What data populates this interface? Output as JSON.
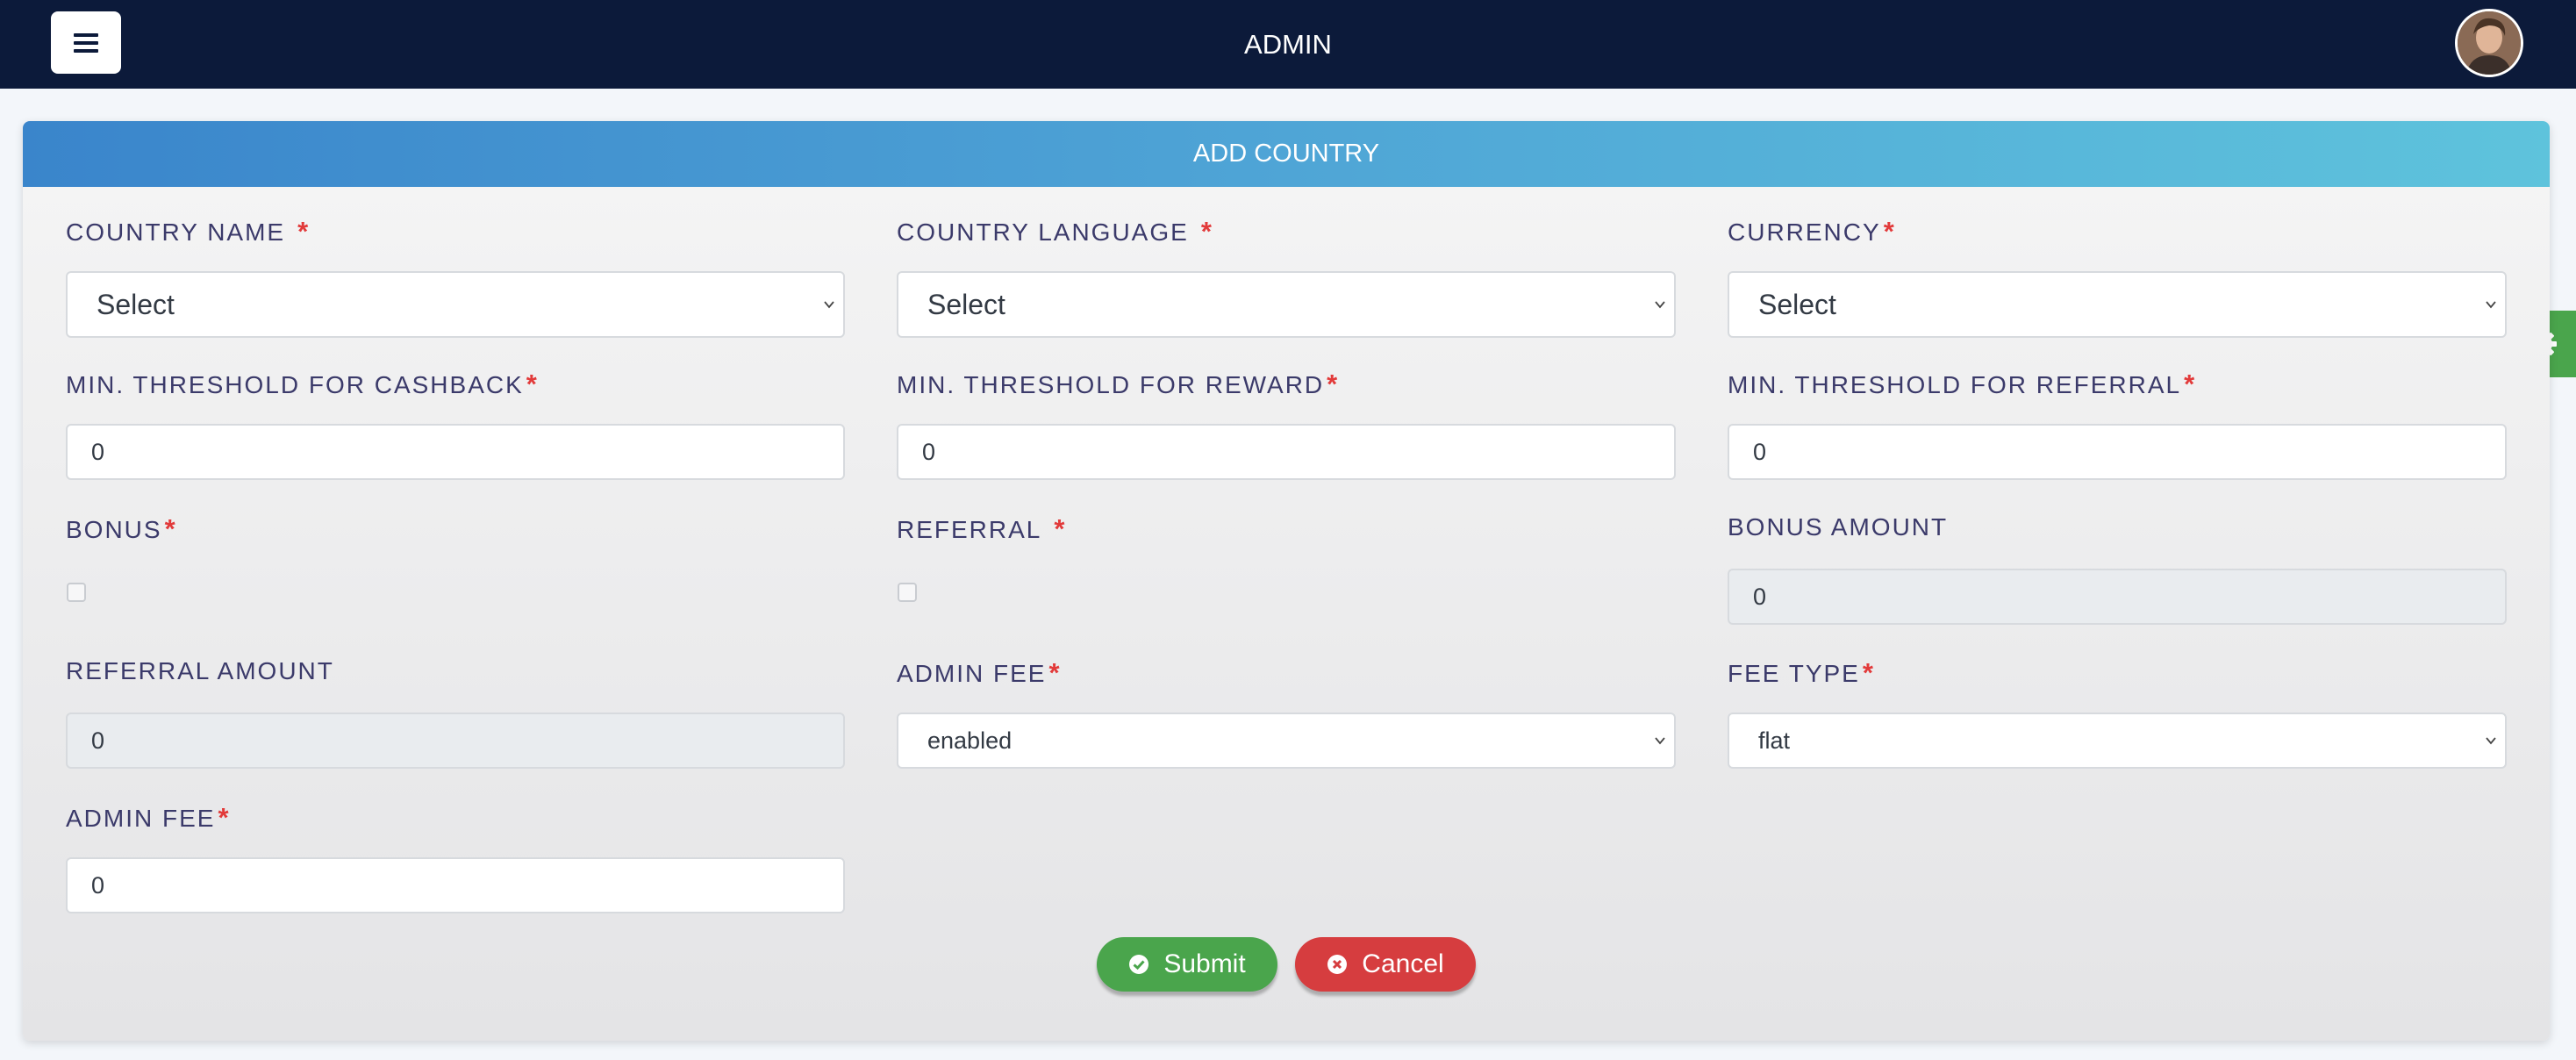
{
  "header": {
    "title": "ADMIN",
    "menu_icon": "hamburger-icon",
    "avatar_icon": "user-avatar"
  },
  "form": {
    "title": "ADD COUNTRY",
    "required_mark": "*",
    "fields": {
      "country_name": {
        "label": "COUNTRY NAME",
        "value": "Select"
      },
      "country_language": {
        "label": "COUNTRY LANGUAGE",
        "value": "Select"
      },
      "currency": {
        "label": "CURRENCY",
        "value": "Select"
      },
      "min_threshold_cashback": {
        "label": "MIN. THRESHOLD FOR CASHBACK",
        "value": "0"
      },
      "min_threshold_reward": {
        "label": "MIN. THRESHOLD FOR REWARD",
        "value": "0"
      },
      "min_threshold_referral": {
        "label": "MIN. THRESHOLD FOR REFERRAL",
        "value": "0"
      },
      "bonus": {
        "label": "BONUS",
        "checked": false
      },
      "referral": {
        "label": "REFERRAL",
        "checked": false
      },
      "bonus_amount": {
        "label": "BONUS AMOUNT",
        "value": "0"
      },
      "referral_amount": {
        "label": "REFERRAL AMOUNT",
        "value": "0"
      },
      "admin_fee_status": {
        "label": "ADMIN FEE",
        "value": "enabled"
      },
      "fee_type": {
        "label": "FEE TYPE",
        "value": "flat"
      },
      "admin_fee_value": {
        "label": "ADMIN FEE",
        "value": "0"
      }
    },
    "buttons": {
      "submit": "Submit",
      "cancel": "Cancel"
    }
  },
  "colors": {
    "topbar": "#0c1a3a",
    "header_gradient_start": "#3a85cb",
    "header_gradient_end": "#5ec3dc",
    "submit": "#4aa54c",
    "cancel": "#d63d3f",
    "required": "#e23a3a",
    "label": "#3b3a6a"
  },
  "icons": {
    "submit": "check-circle-icon",
    "cancel": "times-circle-icon",
    "settings": "gear-icon",
    "dropdown": "chevron-down-icon"
  }
}
